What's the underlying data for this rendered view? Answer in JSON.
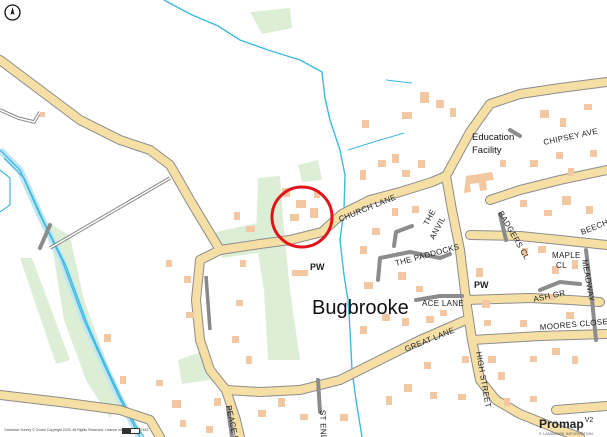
{
  "map": {
    "village_label": "Bugbrooke",
    "facility_label_line1": "Education",
    "facility_label_line2": "Facility",
    "place_of_worship_label": "PW",
    "place_of_worship_label_2": "PW",
    "roads": [
      "CHURCH LANE",
      "THE PADDOCKS",
      "THE",
      "ANVIL",
      "BADGERS CL",
      "CHIPSEY AVE",
      "BEECH",
      "MAPLE",
      "CL",
      "MEADWAY",
      "ASH GR",
      "MOORES CLOSE",
      "ACE LANE",
      "GREAT LANE",
      "HIGH STREET",
      "PEACE H",
      "ST END"
    ],
    "highlight_marker": "subject-property-circle"
  },
  "colors": {
    "road_fill": "#f6dfa4",
    "road_edge": "#8c8c8c",
    "building": "#f3c7a2",
    "green_area": "#dcefd6",
    "water": "#3fb9dd",
    "highlight": "#e2141b"
  },
  "footer": {
    "copyright": "Ordnance Survey © Crown Copyright 2025. All Rights Reserved. Licence number 100022432",
    "brand_name": "Promap",
    "brand_version": "V2",
    "brand_sub": "© LANDMARK INFORMATION"
  },
  "icons": {
    "north_arrow": "north-arrow-icon"
  }
}
